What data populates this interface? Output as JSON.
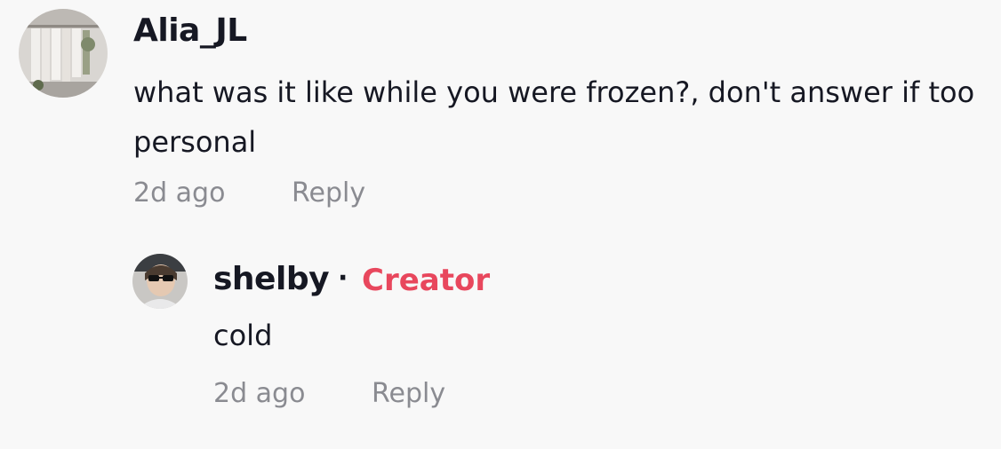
{
  "comments": [
    {
      "username": "Alia_JL",
      "text": "what was it like while you were frozen?, don't answer if too personal",
      "timestamp": "2d ago",
      "reply_label": "Reply",
      "avatar_icon": "user-avatar-photo"
    }
  ],
  "replies": [
    {
      "username": "shelby",
      "separator": "·",
      "badge": "Creator",
      "badge_color": "#e8475d",
      "text": "cold",
      "timestamp": "2d ago",
      "reply_label": "Reply",
      "avatar_icon": "creator-avatar-photo"
    }
  ],
  "colors": {
    "background": "#f8f8f8",
    "text": "#161823",
    "meta": "#8a8b91"
  }
}
